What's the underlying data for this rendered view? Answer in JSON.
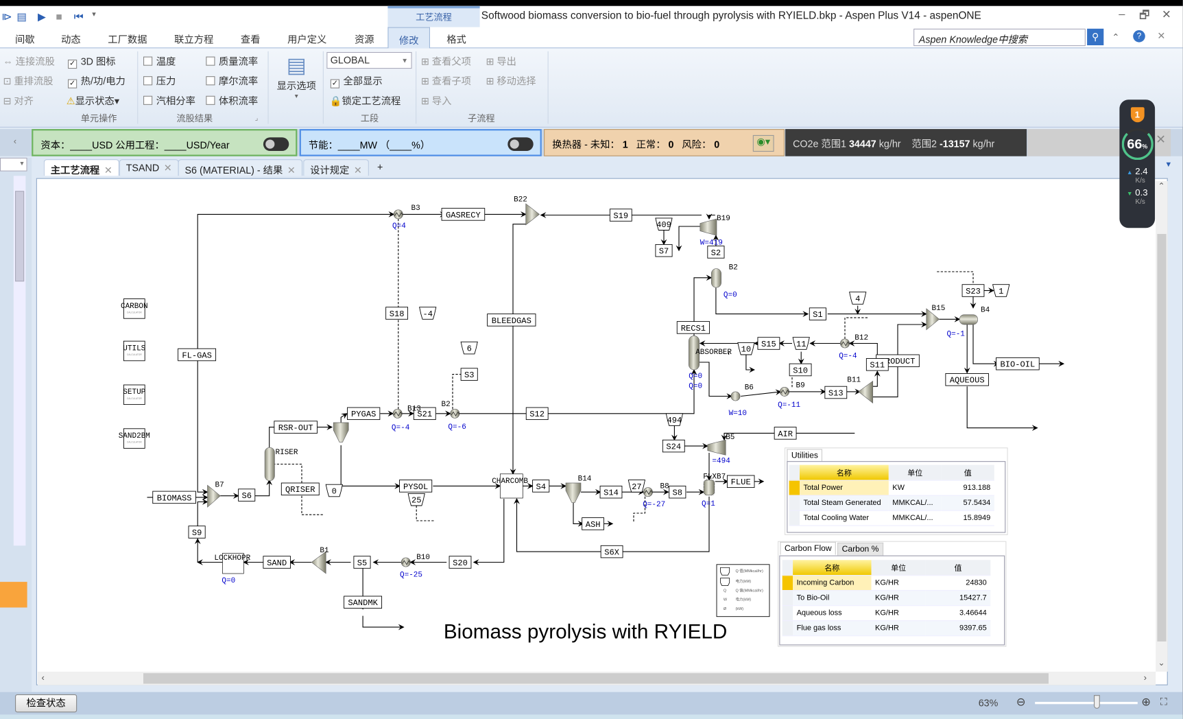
{
  "window": {
    "title": "Softwood biomass conversion to bio-fuel through pyrolysis with RYIELD.bkp - Aspen Plus V14 - aspenONE",
    "context_tab": "工艺流程",
    "controls": [
      "–",
      "🗗",
      "✕"
    ]
  },
  "menu": {
    "items": [
      "间歇",
      "动态",
      "工厂数据",
      "联立方程",
      "查看",
      "用户定义",
      "资源",
      "修改",
      "格式"
    ],
    "selected": "修改",
    "search_placeholder": "Aspen Knowledge中搜索"
  },
  "ribbon": {
    "unit_ops": {
      "label": "单元操作",
      "items": [
        "连接流股",
        "重排流股",
        "对齐"
      ],
      "icon3d": "3D 图标",
      "heat": "热/功/电力",
      "status": "显示状态"
    },
    "stream_results": {
      "label": "流股结果",
      "items": [
        "温度",
        "压力",
        "汽相分率",
        "质量流率",
        "摩尔流率",
        "体积流率"
      ]
    },
    "display_options": "显示选项",
    "section": {
      "label": "工段",
      "select": "GLOBAL",
      "show_all": "全部显示",
      "lock": "锁定工艺流程"
    },
    "subflow": {
      "label": "子流程",
      "items": [
        "查看父项",
        "查看子项",
        "导入",
        "导出",
        "移动选择"
      ]
    }
  },
  "econ": {
    "capital": "资本：____USD  公用工程：____USD/Year",
    "energy": "节能：____MW  （____%）",
    "hx_label": "换热器 - 未知：",
    "hx_unknown": "1",
    "hx_normal_label": "正常：",
    "hx_normal": "0",
    "hx_risk_label": "风险：",
    "hx_risk": "0",
    "co2_label": "CO2e 范围1",
    "co2_scope1": "34447",
    "unit1": "kg/hr",
    "scope2_label": "范围2",
    "co2_scope2": "-13157",
    "unit2": "kg/hr"
  },
  "tabs": [
    "主工艺流程",
    "TSAND",
    "S6 (MATERIAL) - 结果",
    "设计规定"
  ],
  "flowsheet": {
    "streams": [
      "GASRECY",
      "S19",
      "409",
      "S7",
      "S2",
      "S18",
      "-4",
      "BLEEDGAS",
      "S1",
      "4",
      "RECS1",
      "S23",
      "1",
      "FL-GAS",
      "6",
      "S3",
      "PRODUCT",
      "10",
      "S15",
      "11",
      "S10",
      "S11",
      "BIO-OIL",
      "AQUEOUS",
      "S13",
      "PYGAS",
      "S21",
      "S12",
      "494",
      "RSR-OUT",
      "AIR",
      "S24",
      "QRISER",
      "0",
      "PYSOL",
      "25",
      "S4",
      "S14",
      "27",
      "S8",
      "FLUE",
      "BIOMASS",
      "S6",
      "ASH",
      "S9",
      "S6X",
      "SAND",
      "S5",
      "S20",
      "SANDMK"
    ],
    "blocks": [
      "B3",
      "B22",
      "B19",
      "B2",
      "B15",
      "B4",
      "B12",
      "ABSORBER",
      "B6",
      "B9",
      "B11",
      "B13",
      "B2",
      "RISER",
      "B7",
      "CHARCOMB",
      "B14",
      "B8",
      "FLXB7",
      "B1",
      "B10",
      "LOCKHOPR",
      "B5"
    ],
    "duties": [
      "Q=4",
      "W=419",
      "Q=0",
      "Q=-1",
      "Q=-4",
      "Q=0",
      "Q=0",
      "W=10",
      "Q=-11",
      "Q=-4",
      "Q=-6",
      "Q=-27",
      "Q=1",
      "=494",
      "Q=0",
      "Q=-25"
    ],
    "calculators": [
      "CARBON",
      "UTILS",
      "SETUP",
      "SAND2BM"
    ],
    "title": "Biomass pyrolysis with RYIELD"
  },
  "utilities": {
    "tab": "Utilities",
    "headers": [
      "名称",
      "单位",
      "值"
    ],
    "rows": [
      [
        "Total Power",
        "KW",
        "913.188"
      ],
      [
        "Total Steam Generated",
        "MMKCAL/...",
        "57.5434"
      ],
      [
        "Total Cooling Water",
        "MMKCAL/...",
        "15.8949"
      ]
    ]
  },
  "carbon": {
    "tabs": [
      "Carbon Flow",
      "Carbon %"
    ],
    "headers": [
      "名称",
      "单位",
      "值"
    ],
    "rows": [
      [
        "Incoming Carbon",
        "KG/HR",
        "24830"
      ],
      [
        "To Bio-Oil",
        "KG/HR",
        "15427.7"
      ],
      [
        "Aqueous loss",
        "KG/HR",
        "3.46644"
      ],
      [
        "Flue gas loss",
        "KG/HR",
        "9397.65"
      ]
    ]
  },
  "status": {
    "check": "检查状态",
    "zoom": "63%",
    "zoom_level": 63
  },
  "widget": {
    "badge": "1",
    "cpu": "66",
    "up": "2.4",
    "down": "0.3",
    "unit": "K/s"
  },
  "colors": {
    "accent": "#3a63a8",
    "duty": "#0000cc",
    "capital_pane": "#c6e3c0",
    "energy_pane": "#c9e3fb",
    "hx_pane": "#f0d2ad",
    "co2_pane": "#3c3c3c"
  }
}
